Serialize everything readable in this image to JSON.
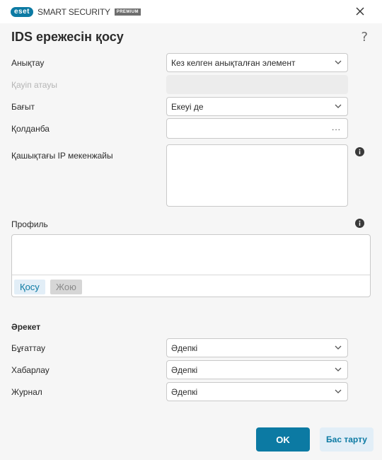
{
  "window": {
    "brand_badge": "eset",
    "brand_name": "SMART SECURITY",
    "brand_edition": "PREMIUM"
  },
  "dialog": {
    "title": "IDS ережесін қосу",
    "help": "?"
  },
  "form": {
    "detection": {
      "label": "Анықтау",
      "value": "Кез келген анықталған элемент"
    },
    "threat_name": {
      "label": "Қауіп атауы",
      "value": ""
    },
    "direction": {
      "label": "Бағыт",
      "value": "Екеуі де"
    },
    "application": {
      "label": "Қолданба",
      "value": "",
      "browse": "..."
    },
    "remote_ip": {
      "label": "Қашықтағы IP мекенжайы",
      "value": ""
    }
  },
  "profile": {
    "label": "Профиль",
    "items": [],
    "add_label": "Қосу",
    "remove_label": "Жою"
  },
  "action": {
    "section_title": "Әрекет",
    "block": {
      "label": "Бұғаттау",
      "value": "Әдепкі"
    },
    "notify": {
      "label": "Хабарлау",
      "value": "Әдепкі"
    },
    "log": {
      "label": "Журнал",
      "value": "Әдепкі"
    }
  },
  "buttons": {
    "ok": "OK",
    "cancel": "Бас тарту"
  },
  "colors": {
    "accent": "#0c7aa3",
    "background": "#f6f6f6",
    "secondary_button": "#e2eef7"
  },
  "icons": {
    "close": "close-icon",
    "help": "help-icon",
    "info": "info-icon",
    "dropdown": "chevron-down-icon"
  }
}
